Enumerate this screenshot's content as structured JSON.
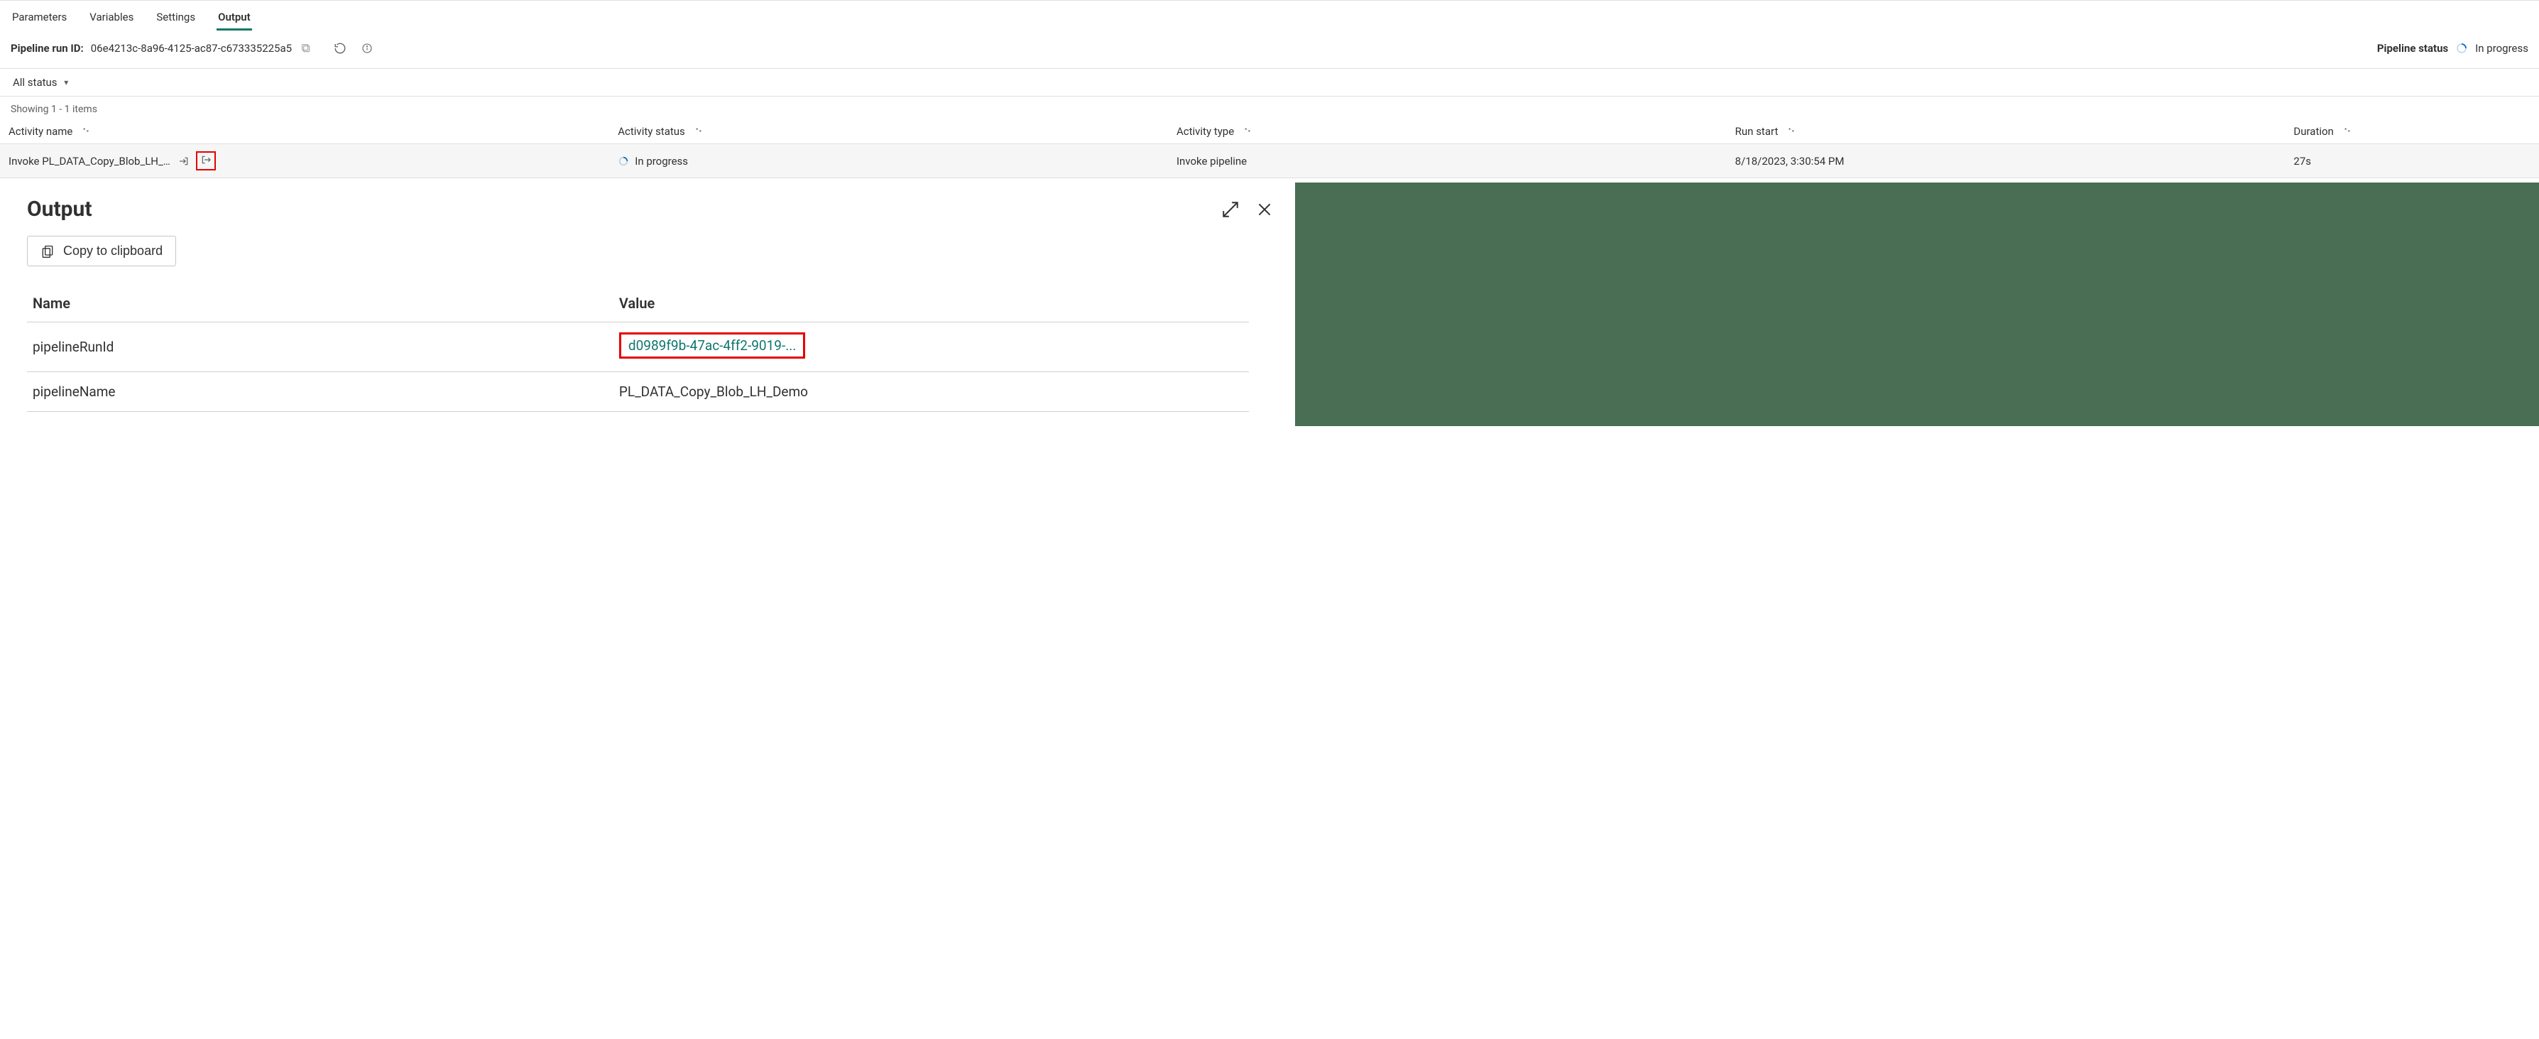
{
  "tabs": {
    "parameters": "Parameters",
    "variables": "Variables",
    "settings": "Settings",
    "output": "Output"
  },
  "run": {
    "id_label": "Pipeline run ID:",
    "id_value": "06e4213c-8a96-4125-ac87-c673335225a5",
    "status_label": "Pipeline status",
    "status_value": "In progress"
  },
  "filter": {
    "all_status": "All status"
  },
  "items_count": "Showing 1 - 1 items",
  "columns": {
    "activity_name": "Activity name",
    "activity_status": "Activity status",
    "activity_type": "Activity type",
    "run_start": "Run start",
    "duration": "Duration"
  },
  "rows": [
    {
      "name": "Invoke PL_DATA_Copy_Blob_LH_De...",
      "status": "In progress",
      "type": "Invoke pipeline",
      "start": "8/18/2023, 3:30:54 PM",
      "duration": "27s"
    }
  ],
  "output_panel": {
    "title": "Output",
    "copy_label": "Copy to clipboard",
    "name_header": "Name",
    "value_header": "Value",
    "rows": [
      {
        "name": "pipelineRunId",
        "value": "d0989f9b-47ac-4ff2-9019-...",
        "link": true,
        "boxed": true
      },
      {
        "name": "pipelineName",
        "value": "PL_DATA_Copy_Blob_LH_Demo",
        "link": false,
        "boxed": false
      }
    ]
  }
}
